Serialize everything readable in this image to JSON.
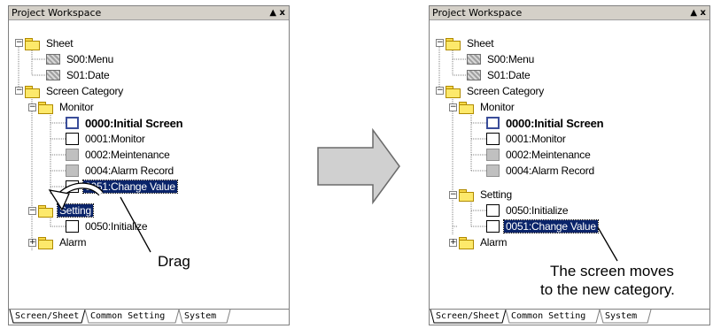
{
  "left_panel": {
    "title": "Project Workspace",
    "title_controls": "▲ x",
    "tree": {
      "sheet_folder": "Sheet",
      "s00": "S00:Menu",
      "s01": "S01:Date",
      "screen_category": "Screen Category",
      "monitor_folder": "Monitor",
      "s0000": "0000:Initial Screen",
      "s0001": "0001:Monitor",
      "s0002": "0002:Meintenance",
      "s0004": "0004:Alarm Record",
      "s0051": "0051:Change Value",
      "setting_folder": "Setting",
      "s0050": "0050:Initialize",
      "alarm_folder": "Alarm"
    },
    "tabs": [
      "Screen/Sheet",
      "Common Setting",
      "System"
    ]
  },
  "right_panel": {
    "title": "Project Workspace",
    "title_controls": "▲ x",
    "tree": {
      "sheet_folder": "Sheet",
      "s00": "S00:Menu",
      "s01": "S01:Date",
      "screen_category": "Screen Category",
      "monitor_folder": "Monitor",
      "s0000": "0000:Initial Screen",
      "s0001": "0001:Monitor",
      "s0002": "0002:Meintenance",
      "s0004": "0004:Alarm Record",
      "setting_folder": "Setting",
      "s0050": "0050:Initialize",
      "s0051": "0051:Change Value",
      "alarm_folder": "Alarm"
    },
    "tabs": [
      "Screen/Sheet",
      "Common Setting",
      "System"
    ]
  },
  "annotations": {
    "drag_label": "Drag",
    "move_caption_line1": "The screen moves",
    "move_caption_line2": "to the new category."
  }
}
